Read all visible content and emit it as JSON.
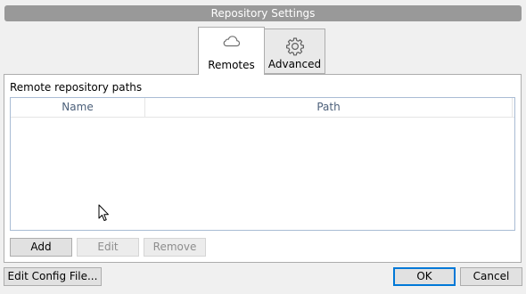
{
  "window": {
    "title": "Repository Settings"
  },
  "tabs": [
    {
      "label": "Remotes",
      "icon": "cloud-icon",
      "active": true
    },
    {
      "label": "Advanced",
      "icon": "gear-icon",
      "active": false
    }
  ],
  "remotes": {
    "section_label": "Remote repository paths",
    "columns": [
      "Name",
      "Path"
    ],
    "rows": [],
    "buttons": {
      "add": "Add",
      "edit": "Edit",
      "remove": "Remove"
    }
  },
  "footer": {
    "edit_config": "Edit Config File...",
    "ok": "OK",
    "cancel": "Cancel"
  }
}
